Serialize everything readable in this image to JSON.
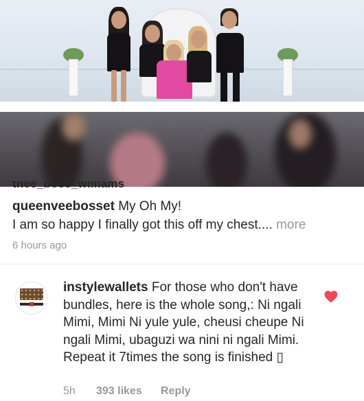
{
  "post": {
    "cut_username": "thee_boss_williams",
    "caption_user": "queenveebosset",
    "caption_title": "My Oh My!",
    "caption_body": "I am so happy I finally got this off my chest....",
    "more_label": "more",
    "time_ago": "6 hours ago"
  },
  "comment": {
    "username": "instylewallets",
    "text": "For those who don't have bundles, here is the whole song,: Ni ngali Mimi, Mimi Ni yule yule, cheusi cheupe Ni ngali Mimi, ubaguzi wa nini ni ngali Mimi. Repeat it 7times the song is finished",
    "emoji": "▯",
    "time": "5h",
    "likes": "393 likes",
    "reply_label": "Reply",
    "liked": true
  },
  "colors": {
    "heart": "#ed4956",
    "muted": "#999999",
    "text": "#262626"
  },
  "icons": {
    "like": "heart-icon",
    "avatar": "wallet-avatar"
  }
}
